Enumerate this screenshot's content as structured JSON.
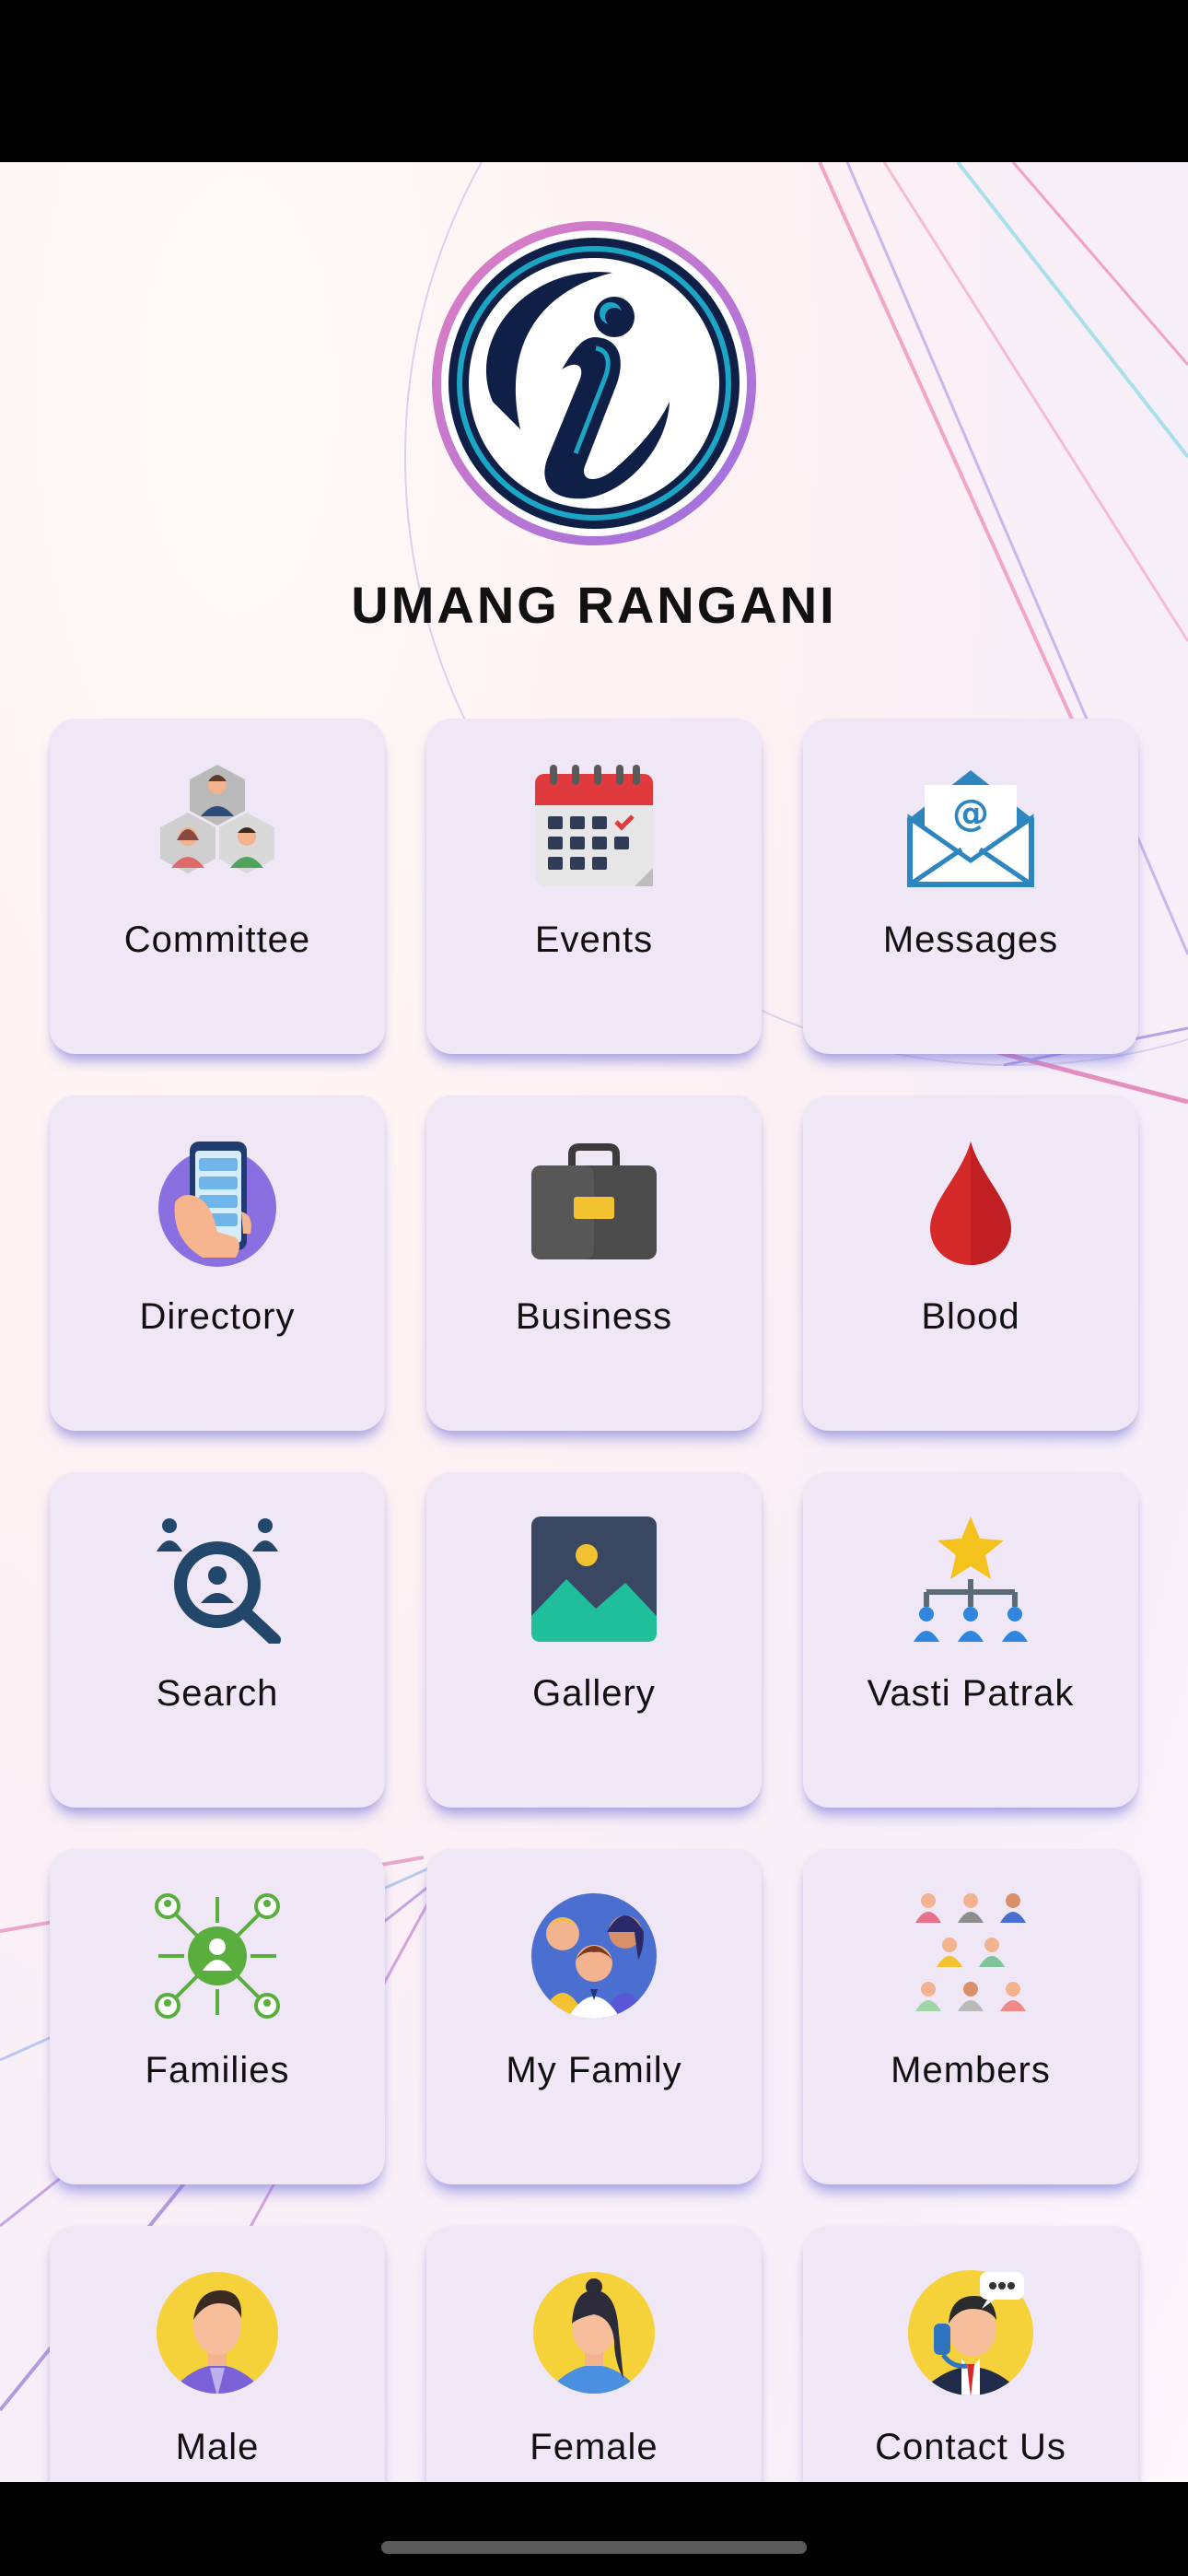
{
  "app": {
    "title": "UMANG RANGANI"
  },
  "tiles": [
    {
      "label": "Committee",
      "icon": "committee-icon"
    },
    {
      "label": "Events",
      "icon": "calendar-icon"
    },
    {
      "label": "Messages",
      "icon": "email-icon"
    },
    {
      "label": "Directory",
      "icon": "phone-directory-icon"
    },
    {
      "label": "Business",
      "icon": "briefcase-icon"
    },
    {
      "label": "Blood",
      "icon": "blood-drop-icon"
    },
    {
      "label": "Search",
      "icon": "people-search-icon"
    },
    {
      "label": "Gallery",
      "icon": "image-gallery-icon"
    },
    {
      "label": "Vasti Patrak",
      "icon": "hierarchy-star-icon"
    },
    {
      "label": "Families",
      "icon": "network-people-icon"
    },
    {
      "label": "My Family",
      "icon": "family-group-icon"
    },
    {
      "label": "Members",
      "icon": "members-grid-icon"
    },
    {
      "label": "Male",
      "icon": "male-avatar-icon"
    },
    {
      "label": "Female",
      "icon": "female-avatar-icon"
    },
    {
      "label": "Contact Us",
      "icon": "support-agent-icon"
    }
  ],
  "colors": {
    "tile_background": "#efe6f6",
    "logo_ring": "#c77bd6",
    "logo_navy": "#0f1f45",
    "logo_teal": "#1aa6c4"
  }
}
